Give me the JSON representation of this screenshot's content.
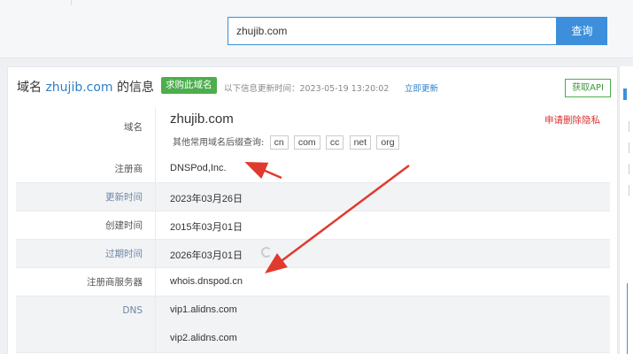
{
  "search": {
    "value": "zhujib.com",
    "button": "查询"
  },
  "header": {
    "title_prefix": "域名",
    "title_domain": "zhujib.com",
    "title_suffix": "的信息",
    "buy_badge": "求购此域名",
    "update_text": "以下信息更新时间：2023-05-19 13:20:02",
    "update_link": "立即更新",
    "api_button": "获取API"
  },
  "rows": {
    "domain": {
      "label": "域名",
      "value": "zhujib.com",
      "suffix_label": "其他常用域名后缀查询:",
      "suffixes": [
        "cn",
        "com",
        "cc",
        "net",
        "org"
      ],
      "delete_privacy": "申请删除隐私"
    },
    "registrar": {
      "label": "注册商",
      "value": "DNSPod,Inc."
    },
    "updated": {
      "label": "更新时间",
      "value": "2023年03月26日"
    },
    "created": {
      "label": "创建时间",
      "value": "2015年03月01日"
    },
    "expires": {
      "label": "过期时间",
      "value": "2026年03月01日"
    },
    "whois_server": {
      "label": "注册商服务器",
      "value": "whois.dnspod.cn"
    },
    "dns": {
      "label": "DNS",
      "values": [
        "vip1.alidns.com",
        "vip2.alidns.com"
      ]
    }
  },
  "colors": {
    "accent": "#3d8fdc",
    "badge_green": "#4cae4c",
    "annotation_red": "#e03a2f",
    "link_blue": "#2e7fc8"
  },
  "icons": {
    "refresh": "refresh-icon"
  }
}
